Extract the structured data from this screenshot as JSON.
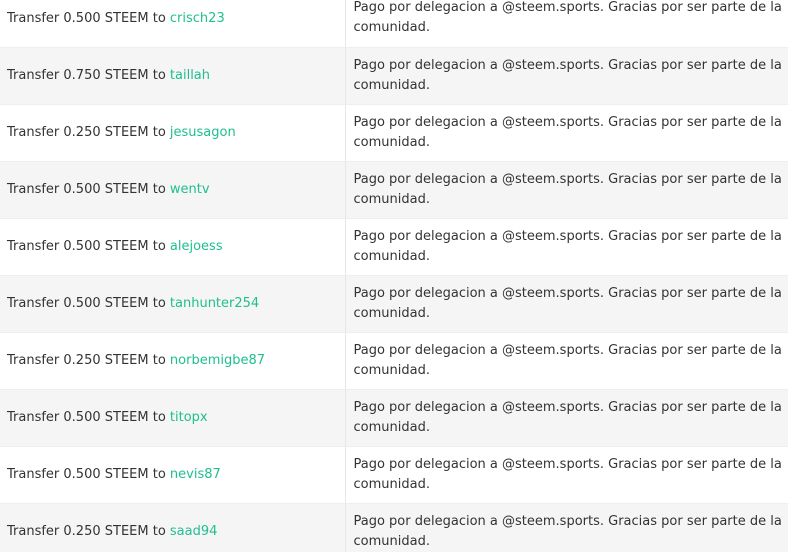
{
  "colors": {
    "link": "#1fbf8f",
    "text": "#333333",
    "row_alt": "#f5f5f5"
  },
  "transfers": [
    {
      "prefix": "Transfer 0.500 STEEM to ",
      "user": "crisch23",
      "memo": "Pago por delegacion a @steem.sports. Gracias por ser parte de la comunidad."
    },
    {
      "prefix": "Transfer 0.750 STEEM to ",
      "user": "taillah",
      "memo": "Pago por delegacion a @steem.sports. Gracias por ser parte de la comunidad."
    },
    {
      "prefix": "Transfer 0.250 STEEM to ",
      "user": "jesusagon",
      "memo": "Pago por delegacion a @steem.sports. Gracias por ser parte de la comunidad."
    },
    {
      "prefix": "Transfer 0.500 STEEM to ",
      "user": "wentv",
      "memo": "Pago por delegacion a @steem.sports. Gracias por ser parte de la comunidad."
    },
    {
      "prefix": "Transfer 0.500 STEEM to ",
      "user": "alejoess",
      "memo": "Pago por delegacion a @steem.sports. Gracias por ser parte de la comunidad."
    },
    {
      "prefix": "Transfer 0.500 STEEM to ",
      "user": "tanhunter254",
      "memo": "Pago por delegacion a @steem.sports. Gracias por ser parte de la comunidad."
    },
    {
      "prefix": "Transfer 0.250 STEEM to ",
      "user": "norbemigbe87",
      "memo": "Pago por delegacion a @steem.sports. Gracias por ser parte de la comunidad."
    },
    {
      "prefix": "Transfer 0.500 STEEM to ",
      "user": "titopx",
      "memo": "Pago por delegacion a @steem.sports. Gracias por ser parte de la comunidad."
    },
    {
      "prefix": "Transfer 0.500 STEEM to ",
      "user": "nevis87",
      "memo": "Pago por delegacion a @steem.sports. Gracias por ser parte de la comunidad."
    },
    {
      "prefix": "Transfer 0.250 STEEM to ",
      "user": "saad94",
      "memo": "Pago por delegacion a @steem.sports. Gracias por ser parte de la comunidad."
    }
  ]
}
